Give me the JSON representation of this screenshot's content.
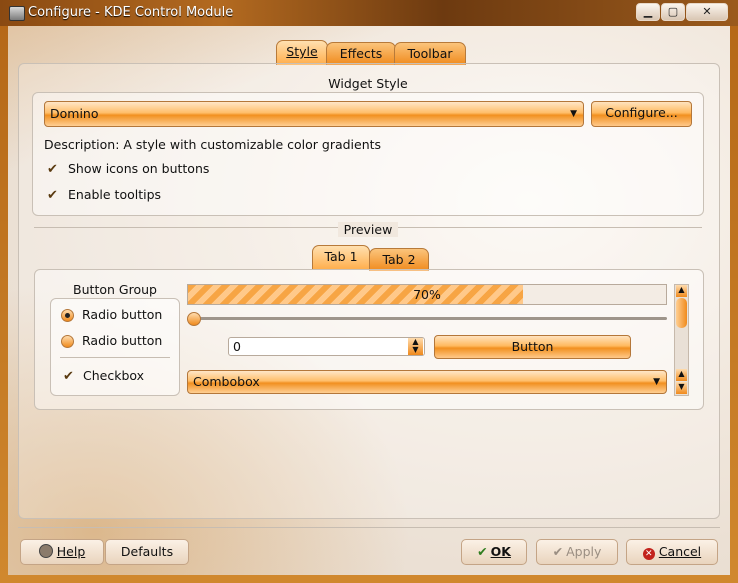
{
  "window": {
    "title": "Configure - KDE Control Module",
    "controls": {
      "minimize": "▁",
      "maximize": "▢",
      "close": "✕"
    }
  },
  "tabs": [
    {
      "label": "Style",
      "active": true
    },
    {
      "label": "Effects",
      "active": false
    },
    {
      "label": "Toolbar",
      "active": false
    }
  ],
  "widget_style": {
    "heading": "Widget Style",
    "selected": "Domino",
    "configure_label": "Configure...",
    "description": "Description: A style with customizable color gradients",
    "show_icons_label": "Show icons on buttons",
    "show_icons_checked": true,
    "tooltips_label": "Enable tooltips",
    "tooltips_checked": true
  },
  "preview": {
    "heading": "Preview",
    "tabs": [
      {
        "label": "Tab 1",
        "active": true
      },
      {
        "label": "Tab 2",
        "active": false
      }
    ],
    "button_group": {
      "title": "Button Group",
      "radio1": "Radio button",
      "radio1_checked": true,
      "radio2": "Radio button",
      "radio2_checked": false,
      "checkbox": "Checkbox",
      "checkbox_checked": true
    },
    "progress": {
      "text": "70%",
      "value": 0.7
    },
    "slider_value": 0.0,
    "spinbox_value": "0",
    "button_label": "Button",
    "combobox_value": "Combobox"
  },
  "buttons": {
    "help": "Help",
    "defaults": "Defaults",
    "ok": "OK",
    "apply": "Apply",
    "cancel": "Cancel"
  },
  "colors": {
    "accent": "#f08a1c",
    "title_bar": "#8a4a12"
  }
}
